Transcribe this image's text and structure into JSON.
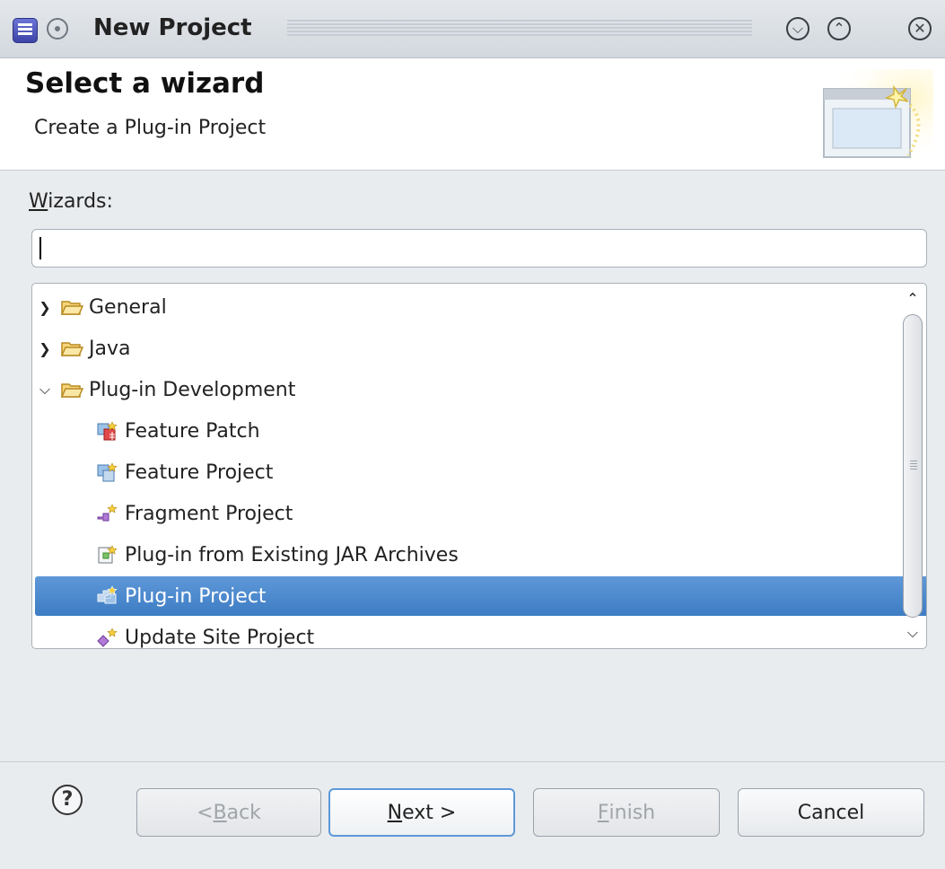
{
  "window": {
    "title": "New Project"
  },
  "header": {
    "title": "Select a wizard",
    "description": "Create a Plug-in Project"
  },
  "wizards": {
    "label_mnemonic": "W",
    "label_rest": "izards:",
    "filter_value": ""
  },
  "tree": {
    "items": [
      {
        "label": "General",
        "icon": "folder-icon",
        "expanded": false,
        "level": 0
      },
      {
        "label": "Java",
        "icon": "folder-icon",
        "expanded": false,
        "level": 0
      },
      {
        "label": "Plug-in Development",
        "icon": "folder-icon",
        "expanded": true,
        "level": 0
      },
      {
        "label": "Feature Patch",
        "icon": "feature-patch-icon",
        "level": 1
      },
      {
        "label": "Feature Project",
        "icon": "feature-project-icon",
        "level": 1
      },
      {
        "label": "Fragment Project",
        "icon": "fragment-project-icon",
        "level": 1
      },
      {
        "label": "Plug-in from Existing JAR Archives",
        "icon": "jar-plugin-icon",
        "level": 1
      },
      {
        "label": "Plug-in Project",
        "icon": "plugin-project-icon",
        "level": 1,
        "selected": true
      },
      {
        "label": "Update Site Project",
        "icon": "update-site-icon",
        "level": 1
      }
    ]
  },
  "buttons": {
    "help": "?",
    "back_pre": "< ",
    "back_mn": "B",
    "back_rest": "ack",
    "next_mn": "N",
    "next_rest": "ext >",
    "finish_mn": "F",
    "finish_rest": "inish",
    "cancel": "Cancel"
  },
  "colors": {
    "selection": "#3d7cc4",
    "folder": "#e8b84a",
    "window_bg": "#e9ecef"
  }
}
